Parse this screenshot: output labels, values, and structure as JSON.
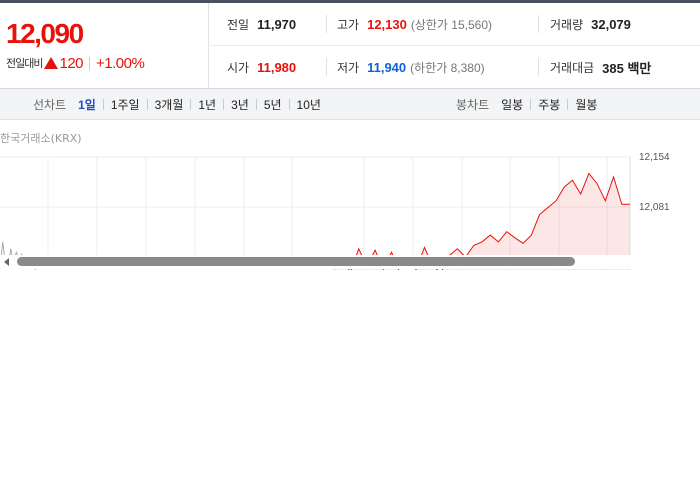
{
  "summary": {
    "current_price": "12,090",
    "change_label": "전일대비",
    "change_amount": "120",
    "change_rate": "+1.00%",
    "stats": {
      "prev_close": {
        "label": "전일",
        "value": "11,970"
      },
      "high": {
        "label": "고가",
        "value": "12,130",
        "sub": "(상한가 15,560)"
      },
      "volume": {
        "label": "거래량",
        "value": "32,079"
      },
      "open": {
        "label": "시가",
        "value": "11,980"
      },
      "low": {
        "label": "저가",
        "value": "11,940",
        "sub": "(하한가 8,380)"
      },
      "trade_value": {
        "label": "거래대금",
        "value": "385 백만"
      }
    },
    "colors": {
      "up": "#e8120c",
      "down": "#1160d8"
    }
  },
  "toolbar": {
    "line_chart_title": "선차트",
    "periods": [
      "1일",
      "1주일",
      "3개월",
      "1년",
      "3년",
      "5년",
      "10년"
    ],
    "active_period": "1일",
    "candle_chart_title": "봉차트",
    "candle_periods": [
      "일봉",
      "주봉",
      "월봉"
    ]
  },
  "chart": {
    "exchange_label": "한국거래소(KRX)",
    "y_tick_labels": [
      "12,154",
      "12,081"
    ]
  },
  "chart_data": {
    "type": "line",
    "title": "",
    "xlabel": "",
    "ylabel": "",
    "ylim": [
      11970,
      12154
    ],
    "y_ticks": [
      12154,
      12081
    ],
    "grid": true,
    "series": [
      {
        "color": "#aaaaaa",
        "values": [
          11990,
          12030,
          12000,
          11995,
          12020,
          11998,
          12015,
          12005,
          12012,
          12000,
          12008,
          11996,
          12010,
          11990,
          11985,
          11980,
          11975,
          11980
        ]
      },
      {
        "color": "#e8120c",
        "values": [
          11990,
          12010,
          11985,
          12020,
          11995,
          12018,
          11990,
          12015,
          11985,
          11980,
          11990,
          12022,
          11995,
          11985,
          12010,
          12020,
          12008,
          12025,
          12030,
          12040,
          12030,
          12045,
          12036,
          12028,
          12040,
          12070,
          12080,
          12090,
          12110,
          12120,
          12100,
          12130,
          12115,
          12090,
          12125,
          12085,
          12085
        ]
      }
    ]
  }
}
